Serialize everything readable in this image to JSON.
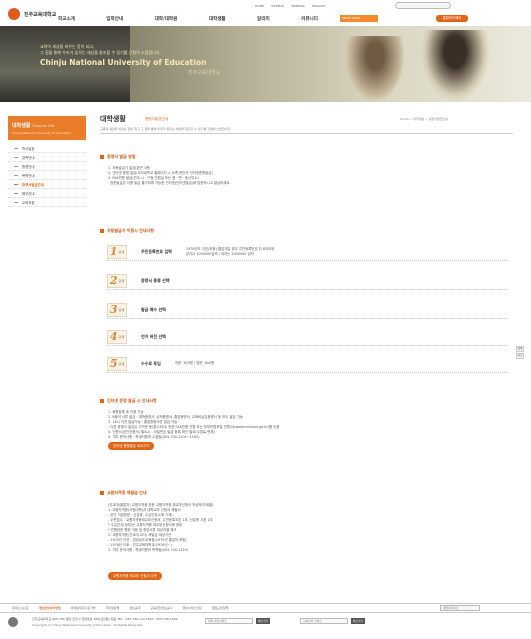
{
  "header": {
    "logo_text": "진주교육대학교",
    "utility": [
      "HOME",
      "SITEMAP",
      "WEBMAIL",
      "ENGLISH"
    ],
    "gnb": [
      "학교소개",
      "입학안내",
      "대학/대학원",
      "대학생활",
      "알리미",
      "커뮤니티"
    ],
    "select_label": "MENU LINKS",
    "mypage_btn": "통합마이페이"
  },
  "hero": {
    "line1": "교육이 세상을 바꾸는 힘이 되고,",
    "line2": "그 힘을 통해 우리가 꿈꾸는 세상을 창조할 수 있기를 간절히 소망합니다.",
    "line3": "Chinju National University of Education",
    "line4": "진주교육대학교"
  },
  "sidebar": {
    "title": "대학생활",
    "title_en": "Campus Life",
    "subtitle": "Chinju National University of Education",
    "items": [
      {
        "label": "학사일정"
      },
      {
        "label": "장학안내"
      },
      {
        "label": "증명안내"
      },
      {
        "label": "복학안내"
      },
      {
        "label": "증명서발급안내"
      },
      {
        "label": "병무안내"
      },
      {
        "label": "교육과정"
      }
    ]
  },
  "page": {
    "title": "대학생활",
    "sub": "증명서발급안내",
    "crumb": "Home > 대학생활 > 증명서발급안내",
    "desc": "교육의 세상을 바꾸는 힘이 되고 그 힘을 통해 우리가 꿈꾸는 세상을 창조할 수 있기를 간절히 소망합니다."
  },
  "sections": {
    "issue": {
      "title": "증명서 발급 방법",
      "lines": [
        "1. 자동발급기 발급(본관 1층)",
        "2. 인터넷 증명 발급(우리대학교 홈페이지 > 우측 하단의 인터넷증명발급)",
        "3. FAX민원 발급(전국 시 · 구청 민원실 또는 읍 · 면 · 동사무소)",
        "· 방문발급은 이용 발급 불가하며 가능한 인터넷(인터넷발급)에 방문하시고 발급하세요."
      ]
    },
    "kiosk": {
      "title": "자동발급기 이용시 안내사항",
      "steps": [
        {
          "num": "1",
          "unit": "단계",
          "label": "주민등록번호 입력",
          "extra1": "1978년도 이전(포함) 졸업자일 경우 주민등록번호 뒤 6자리와",
          "extra2": "같거나 1000000입력 / 여자는 2000000 입력"
        },
        {
          "num": "2",
          "unit": "단계",
          "label": "증명서 종류 선택",
          "extra1": "",
          "extra2": ""
        },
        {
          "num": "3",
          "unit": "단계",
          "label": "발급 매수 선택",
          "extra1": "",
          "extra2": ""
        },
        {
          "num": "4",
          "unit": "단계",
          "label": "언어 버전 선택",
          "extra1": "",
          "extra2": ""
        },
        {
          "num": "5",
          "unit": "단계",
          "label": "수수료 투입",
          "extra1": "국문: 300원 / 영문: 600원",
          "extra2": ""
        }
      ]
    },
    "online": {
      "title": "인터넷 증명 발급 시 안내사항",
      "lines": [
        "1. 회원등록 후 이용 가능",
        "2. 8종의 서류 발급 : 재학증명서, 성적증명서, 졸업증명서, 교육비납입증명서 등 모두 발급 가능",
        "3. 18시 이전 발급가능 : 졸업증명서만 발급 가능",
        "- 다른 증명서 발급은 가까운 동(읍)사무소 방문 FAX민원 신청 또는 정부민원포털 민원24(www.minwon.go.kr)를 이용",
        "4. 인증서(공인인증서) 필요시 : 비밀번호 발급 등록 확인 필요(수업료 면제)",
        "5. 기타 문의사항 : 학생지원과 수업팀(055-740-1101~1162)"
      ],
      "button": "인터넷 증명발급 바로가기"
    },
    "teacher": {
      "title": "교원자격증 재발급 안내",
      "lines": [
        "[진교대(졸업자) 교원자격증 방문 교원자격증 재교부신청서 작성하여 제출]",
        "1. 교원자격증(사범대학)과 대학교부 신청서 제출서",
        "- 본인 직접방문 : 신분증, 수입인지(1매 기재)",
        "- 우편접수 : 교원자격증재교부신청서, 주민등록초본 1부, 신분증 사본 1부",
        "* 수입인지(정부)는 교원자격증 재교부신청서에 첨부",
        "* 민원방문 행정 이용 및 증빙서류 대상자별 체크",
        "2. 교원자격증(진교대 교사) 재발급 대상기관",
        "- 1975년 이전 : 경상남도교육청(1975년 졸업자 포함)",
        "- 1976년 이후 : 진주교육대학교(1976년~)",
        "3. 기타 문의사항 : 학생지원과 학적팀(055-740-1120)"
      ],
      "button": "교원자격증 재교부 신청서 다운"
    }
  },
  "zoom": [
    "확대",
    "축소"
  ],
  "footer": {
    "nav": [
      {
        "label": "찾아오시는길",
        "on": false
      },
      {
        "label": "개인정보처리방침",
        "on": true
      },
      {
        "label": "이메일무단수집거부",
        "on": false
      },
      {
        "label": "저작권정책",
        "on": false
      },
      {
        "label": "정보공개",
        "on": false
      },
      {
        "label": "교육관련정보공시",
        "on": false
      },
      {
        "label": "행정서비스헌장",
        "on": false
      },
      {
        "label": "웹접근성정책",
        "on": false
      }
    ],
    "family_site": "패밀리사이트",
    "address": "진주교육대학교 660-756 경남 진주시 진양호로 369(신안동) 대표 TEL : 055-740-1114 FAX : 055-740-1000",
    "copyright": "Copyright (c) Chinju National University of Education. All Rights Reserved.",
    "select1": "대학 관련사이트",
    "select2": "교육관련 사이트",
    "go": "바로가기"
  }
}
